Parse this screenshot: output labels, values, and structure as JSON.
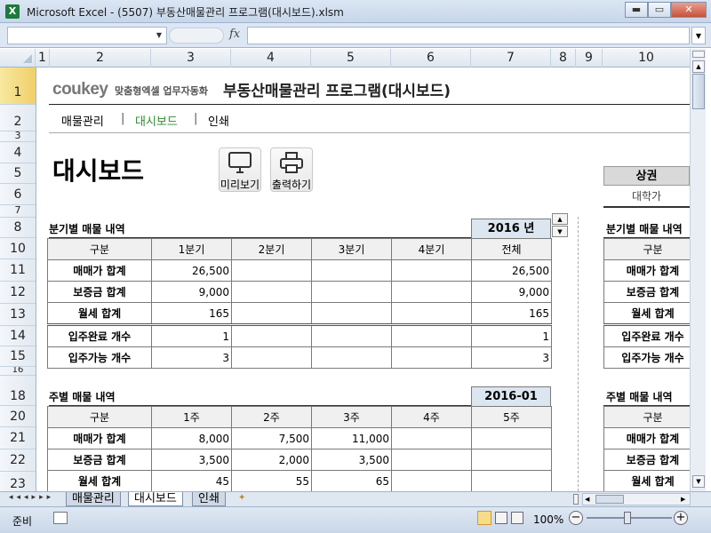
{
  "window": {
    "title": "Microsoft Excel - (5507) 부동산매물관리 프로그램(대시보드).xlsm",
    "app_icon": "X"
  },
  "formula_bar": {
    "fx": "fx"
  },
  "columns": [
    "1",
    "2",
    "3",
    "4",
    "5",
    "6",
    "7",
    "8",
    "9",
    "10"
  ],
  "rows": [
    "1",
    "2",
    "3",
    "4",
    "5",
    "6",
    "7",
    "8",
    "10",
    "11",
    "12",
    "13",
    "14",
    "15",
    "16",
    "18",
    "20",
    "21",
    "22",
    "23"
  ],
  "header": {
    "logo": "coukey",
    "logo_sub": "맞춤형엑셀 업무자동화",
    "title": "부동산매물관리 프로그램(대시보드)",
    "nav": [
      "매물관리",
      "대시보드",
      "인쇄"
    ],
    "nav_sep": "|"
  },
  "page_heading": "대시보드",
  "buttons": {
    "preview": "미리보기",
    "print": "출력하기"
  },
  "right_panel": {
    "header": "상권",
    "value": "대학가"
  },
  "quarterly": {
    "title": "분기별 매물 내역",
    "year": "2016 년",
    "headers": [
      "구분",
      "1분기",
      "2분기",
      "3분기",
      "4분기",
      "전체"
    ],
    "rows": [
      [
        "매매가 합계",
        "26,500",
        "",
        "",
        "",
        "26,500"
      ],
      [
        "보증금 합계",
        "9,000",
        "",
        "",
        "",
        "9,000"
      ],
      [
        "월세 합계",
        "165",
        "",
        "",
        "",
        "165"
      ],
      [
        "입주완료 개수",
        "1",
        "",
        "",
        "",
        "1"
      ],
      [
        "입주가능 개수",
        "3",
        "",
        "",
        "",
        "3"
      ]
    ],
    "right_title": "분기별 매물 내역",
    "right_rows": [
      "구분",
      "매매가 합계",
      "보증금 합계",
      "월세 합계",
      "입주완료 개수",
      "입주가능 개수"
    ]
  },
  "weekly": {
    "title": "주별 매물 내역",
    "month": "2016-01",
    "headers": [
      "구분",
      "1주",
      "2주",
      "3주",
      "4주",
      "5주"
    ],
    "rows": [
      [
        "매매가 합계",
        "8,000",
        "7,500",
        "11,000",
        "",
        ""
      ],
      [
        "보증금 합계",
        "3,500",
        "2,000",
        "3,500",
        "",
        ""
      ],
      [
        "월세 합계",
        "45",
        "55",
        "65",
        "",
        ""
      ]
    ],
    "right_title": "주별 매물 내역",
    "right_rows": [
      "구분",
      "매매가 합계",
      "보증금 합계",
      "월세 합계"
    ]
  },
  "sheet_tabs": [
    "매물관리",
    "대시보드",
    "인쇄"
  ],
  "status": {
    "ready": "준비",
    "zoom": "100%"
  }
}
